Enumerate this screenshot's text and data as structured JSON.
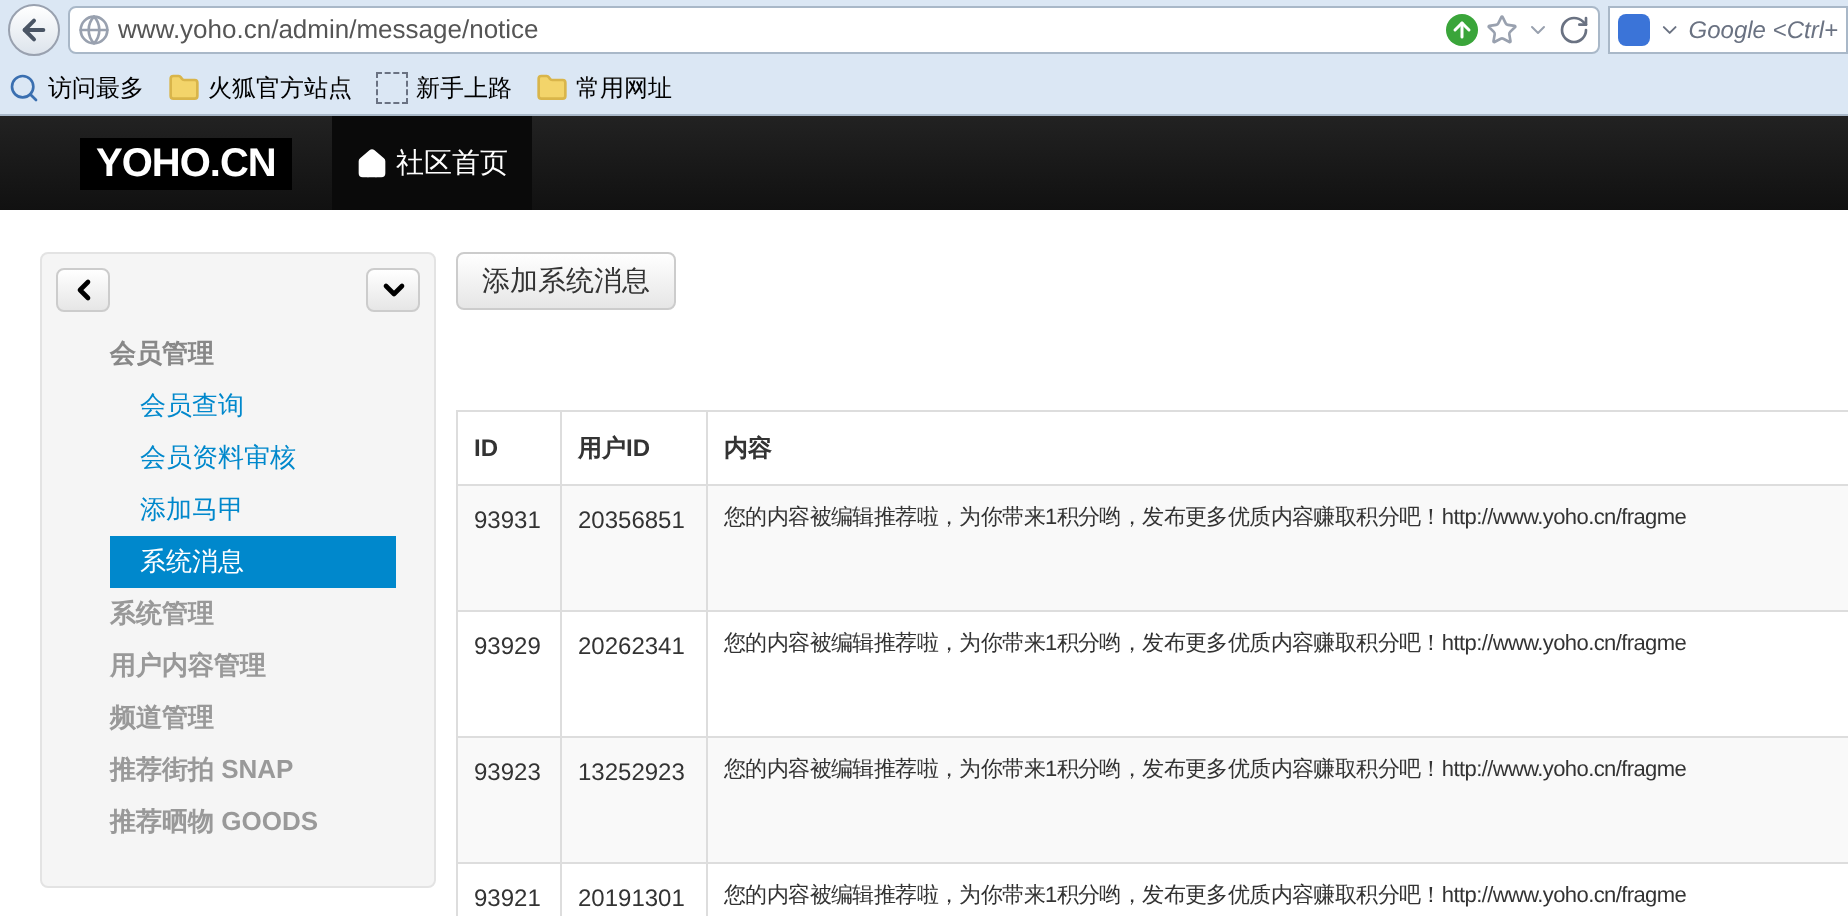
{
  "browser": {
    "url": "www.yoho.cn/admin/message/notice",
    "search_placeholder": "Google <Ctrl+",
    "bookmarks": [
      {
        "label": "访问最多",
        "kind": "smart"
      },
      {
        "label": "火狐官方站点",
        "kind": "folder"
      },
      {
        "label": "新手上路",
        "kind": "page"
      },
      {
        "label": "常用网址",
        "kind": "folder"
      }
    ]
  },
  "navbar": {
    "logo": "YOHO.CN",
    "links": [
      {
        "label": "社区首页",
        "selected": true
      }
    ]
  },
  "sidebar": {
    "groups": [
      {
        "label": "会员管理",
        "expanded": true,
        "children": [
          {
            "label": "会员查询",
            "selected": false
          },
          {
            "label": "会员资料审核",
            "selected": false
          },
          {
            "label": "添加马甲",
            "selected": false
          },
          {
            "label": "系统消息",
            "selected": true
          }
        ]
      },
      {
        "label": "系统管理",
        "expanded": false
      },
      {
        "label": "用户内容管理",
        "expanded": false
      },
      {
        "label": "频道管理",
        "expanded": false
      },
      {
        "label": "推荐街拍 SNAP",
        "expanded": false
      },
      {
        "label": "推荐晒物 GOODS",
        "expanded": false
      }
    ]
  },
  "add_button": "添加系统消息",
  "table": {
    "columns": [
      "ID",
      "用户ID",
      "内容"
    ],
    "rows": [
      [
        "93931",
        "20356851",
        "您的内容被编辑推荐啦，为你带来1积分哟，发布更多优质内容赚取积分吧！http://www.yoho.cn/fragme"
      ],
      [
        "93929",
        "20262341",
        "您的内容被编辑推荐啦，为你带来1积分哟，发布更多优质内容赚取积分吧！http://www.yoho.cn/fragme"
      ],
      [
        "93923",
        "13252923",
        "您的内容被编辑推荐啦，为你带来1积分哟，发布更多优质内容赚取积分吧！http://www.yoho.cn/fragme"
      ],
      [
        "93921",
        "20191301",
        "您的内容被编辑推荐啦，为你带来1积分哟，发布更多优质内容赚取积分吧！http://www.yoho.cn/fragme"
      ]
    ]
  }
}
